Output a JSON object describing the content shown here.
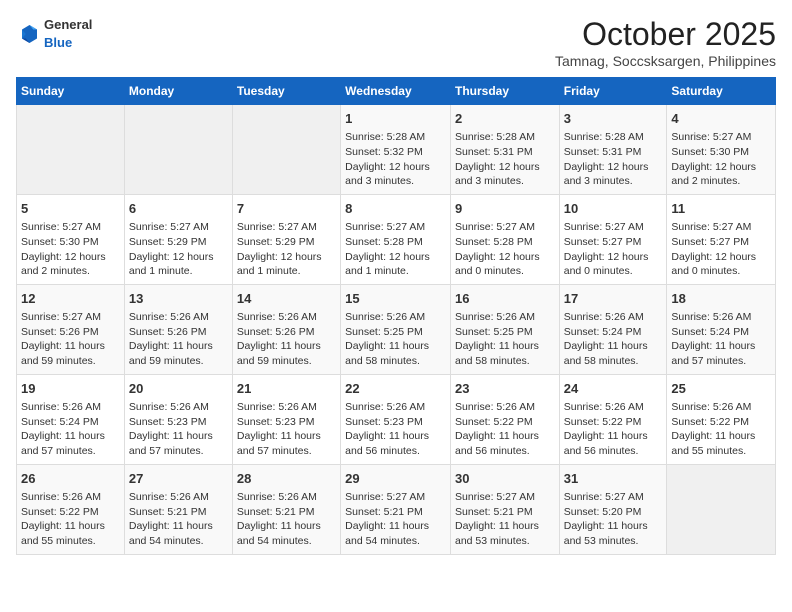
{
  "header": {
    "logo": {
      "general": "General",
      "blue": "Blue"
    },
    "title": "October 2025",
    "subtitle": "Tamnag, Soccsksargen, Philippines"
  },
  "weekdays": [
    "Sunday",
    "Monday",
    "Tuesday",
    "Wednesday",
    "Thursday",
    "Friday",
    "Saturday"
  ],
  "weeks": [
    [
      {
        "day": "",
        "empty": true
      },
      {
        "day": "",
        "empty": true
      },
      {
        "day": "",
        "empty": true
      },
      {
        "day": "1",
        "sunrise": "5:28 AM",
        "sunset": "5:32 PM",
        "daylight": "12 hours and 3 minutes."
      },
      {
        "day": "2",
        "sunrise": "5:28 AM",
        "sunset": "5:31 PM",
        "daylight": "12 hours and 3 minutes."
      },
      {
        "day": "3",
        "sunrise": "5:28 AM",
        "sunset": "5:31 PM",
        "daylight": "12 hours and 3 minutes."
      },
      {
        "day": "4",
        "sunrise": "5:27 AM",
        "sunset": "5:30 PM",
        "daylight": "12 hours and 2 minutes."
      }
    ],
    [
      {
        "day": "5",
        "sunrise": "5:27 AM",
        "sunset": "5:30 PM",
        "daylight": "12 hours and 2 minutes."
      },
      {
        "day": "6",
        "sunrise": "5:27 AM",
        "sunset": "5:29 PM",
        "daylight": "12 hours and 1 minute."
      },
      {
        "day": "7",
        "sunrise": "5:27 AM",
        "sunset": "5:29 PM",
        "daylight": "12 hours and 1 minute."
      },
      {
        "day": "8",
        "sunrise": "5:27 AM",
        "sunset": "5:28 PM",
        "daylight": "12 hours and 1 minute."
      },
      {
        "day": "9",
        "sunrise": "5:27 AM",
        "sunset": "5:28 PM",
        "daylight": "12 hours and 0 minutes."
      },
      {
        "day": "10",
        "sunrise": "5:27 AM",
        "sunset": "5:27 PM",
        "daylight": "12 hours and 0 minutes."
      },
      {
        "day": "11",
        "sunrise": "5:27 AM",
        "sunset": "5:27 PM",
        "daylight": "12 hours and 0 minutes."
      }
    ],
    [
      {
        "day": "12",
        "sunrise": "5:27 AM",
        "sunset": "5:26 PM",
        "daylight": "11 hours and 59 minutes."
      },
      {
        "day": "13",
        "sunrise": "5:26 AM",
        "sunset": "5:26 PM",
        "daylight": "11 hours and 59 minutes."
      },
      {
        "day": "14",
        "sunrise": "5:26 AM",
        "sunset": "5:26 PM",
        "daylight": "11 hours and 59 minutes."
      },
      {
        "day": "15",
        "sunrise": "5:26 AM",
        "sunset": "5:25 PM",
        "daylight": "11 hours and 58 minutes."
      },
      {
        "day": "16",
        "sunrise": "5:26 AM",
        "sunset": "5:25 PM",
        "daylight": "11 hours and 58 minutes."
      },
      {
        "day": "17",
        "sunrise": "5:26 AM",
        "sunset": "5:24 PM",
        "daylight": "11 hours and 58 minutes."
      },
      {
        "day": "18",
        "sunrise": "5:26 AM",
        "sunset": "5:24 PM",
        "daylight": "11 hours and 57 minutes."
      }
    ],
    [
      {
        "day": "19",
        "sunrise": "5:26 AM",
        "sunset": "5:24 PM",
        "daylight": "11 hours and 57 minutes."
      },
      {
        "day": "20",
        "sunrise": "5:26 AM",
        "sunset": "5:23 PM",
        "daylight": "11 hours and 57 minutes."
      },
      {
        "day": "21",
        "sunrise": "5:26 AM",
        "sunset": "5:23 PM",
        "daylight": "11 hours and 57 minutes."
      },
      {
        "day": "22",
        "sunrise": "5:26 AM",
        "sunset": "5:23 PM",
        "daylight": "11 hours and 56 minutes."
      },
      {
        "day": "23",
        "sunrise": "5:26 AM",
        "sunset": "5:22 PM",
        "daylight": "11 hours and 56 minutes."
      },
      {
        "day": "24",
        "sunrise": "5:26 AM",
        "sunset": "5:22 PM",
        "daylight": "11 hours and 56 minutes."
      },
      {
        "day": "25",
        "sunrise": "5:26 AM",
        "sunset": "5:22 PM",
        "daylight": "11 hours and 55 minutes."
      }
    ],
    [
      {
        "day": "26",
        "sunrise": "5:26 AM",
        "sunset": "5:22 PM",
        "daylight": "11 hours and 55 minutes."
      },
      {
        "day": "27",
        "sunrise": "5:26 AM",
        "sunset": "5:21 PM",
        "daylight": "11 hours and 54 minutes."
      },
      {
        "day": "28",
        "sunrise": "5:26 AM",
        "sunset": "5:21 PM",
        "daylight": "11 hours and 54 minutes."
      },
      {
        "day": "29",
        "sunrise": "5:27 AM",
        "sunset": "5:21 PM",
        "daylight": "11 hours and 54 minutes."
      },
      {
        "day": "30",
        "sunrise": "5:27 AM",
        "sunset": "5:21 PM",
        "daylight": "11 hours and 53 minutes."
      },
      {
        "day": "31",
        "sunrise": "5:27 AM",
        "sunset": "5:20 PM",
        "daylight": "11 hours and 53 minutes."
      },
      {
        "day": "",
        "empty": true
      }
    ]
  ]
}
